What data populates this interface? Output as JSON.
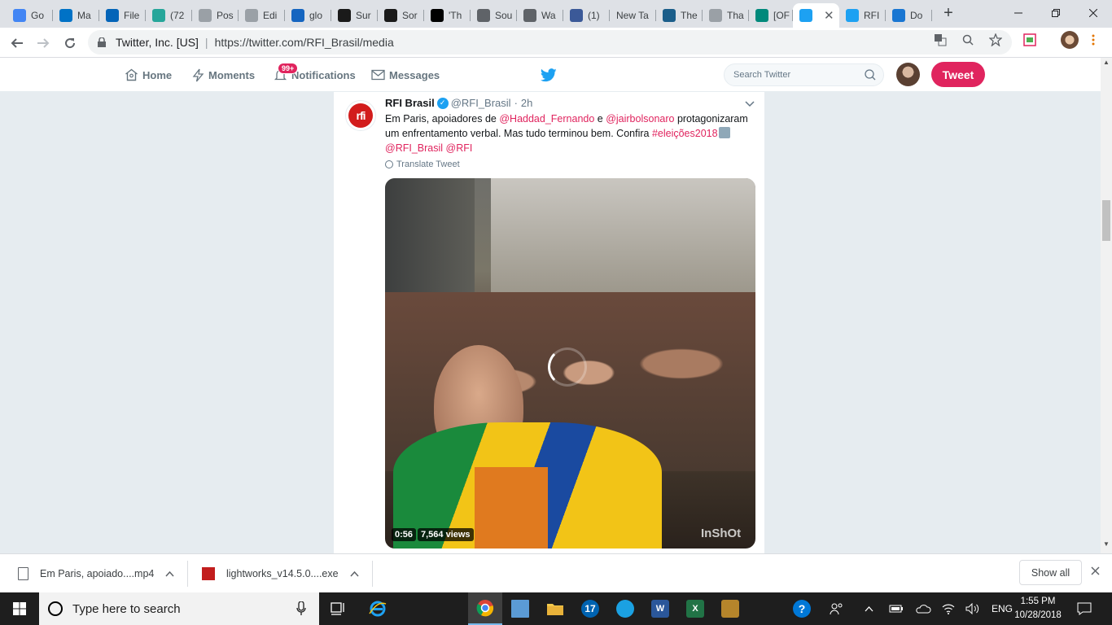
{
  "browser": {
    "tabs": [
      {
        "label": "Go",
        "icon": "google-icon",
        "color": "#4285f4"
      },
      {
        "label": "Ma",
        "icon": "outlook-icon",
        "color": "#0072c6"
      },
      {
        "label": "File",
        "icon": "onedrive-icon",
        "color": "#0364b8"
      },
      {
        "label": "(72",
        "icon": "green-badge-icon",
        "color": "#26a69a"
      },
      {
        "label": "Pos",
        "icon": "document-icon",
        "color": "#9aa0a6"
      },
      {
        "label": "Edi",
        "icon": "document-icon",
        "color": "#9aa0a6"
      },
      {
        "label": "glo",
        "icon": "g-blue-icon",
        "color": "#1565c0"
      },
      {
        "label": "Sur",
        "icon": "s-black-icon",
        "color": "#1a1a1a"
      },
      {
        "label": "Sor",
        "icon": "s-black-icon",
        "color": "#1a1a1a"
      },
      {
        "label": "'Th",
        "icon": "imdb-icon",
        "color": "#000000"
      },
      {
        "label": "Sou",
        "icon": "globe-icon",
        "color": "#5f6368"
      },
      {
        "label": "Wa",
        "icon": "globe-icon",
        "color": "#5f6368"
      },
      {
        "label": "(1)",
        "icon": "facebook-icon",
        "color": "#3b5998"
      },
      {
        "label": "New Ta",
        "icon": "",
        "color": ""
      },
      {
        "label": "The",
        "icon": "tr-icon",
        "color": "#1b5e8a"
      },
      {
        "label": "Tha",
        "icon": "puzzle-icon",
        "color": "#9aa0a6"
      },
      {
        "label": "[OF",
        "icon": "feather-icon",
        "color": "#00897b"
      },
      {
        "label": "",
        "icon": "twitter-icon",
        "color": "#1da1f2",
        "active": true
      },
      {
        "label": "RFI",
        "icon": "twitter-icon",
        "color": "#1da1f2"
      },
      {
        "label": "Do",
        "icon": "github-icon",
        "color": "#1976d2"
      }
    ],
    "origin": "Twitter, Inc. [US]",
    "url": "https://twitter.com/RFI_Brasil/media"
  },
  "twitter_nav": {
    "home": "Home",
    "moments": "Moments",
    "notifications": "Notifications",
    "notifications_badge": "99+",
    "messages": "Messages",
    "search_placeholder": "Search Twitter",
    "tweet_button": "Tweet"
  },
  "tweet": {
    "logo_text": "rfi",
    "account_name": "RFI Brasil",
    "handle": "@RFI_Brasil",
    "dot": "·",
    "age": "2h",
    "text_1": "Em Paris, apoiadores de ",
    "mention_1": "@Haddad_Fernando",
    "text_2": " e ",
    "mention_2": "@jairbolsonaro",
    "text_3": " protagonizaram um enfrentamento verbal. Mas tudo terminou bem. Confira ",
    "hashtag": "#eleições2018",
    "mention_3": "@RFI_Brasil",
    "mention_4": "@RFI",
    "translate": "Translate Tweet",
    "video_duration": "0:56",
    "video_views": "7,564 views",
    "watermark": "InShOt"
  },
  "downloads": {
    "items": [
      {
        "name": "Em Paris, apoiado....mp4"
      },
      {
        "name": "lightworks_v14.5.0....exe"
      }
    ],
    "show_all": "Show all"
  },
  "taskbar": {
    "search_placeholder": "Type here to search",
    "lang": "ENG",
    "time": "1:55 PM",
    "date": "10/28/2018"
  }
}
